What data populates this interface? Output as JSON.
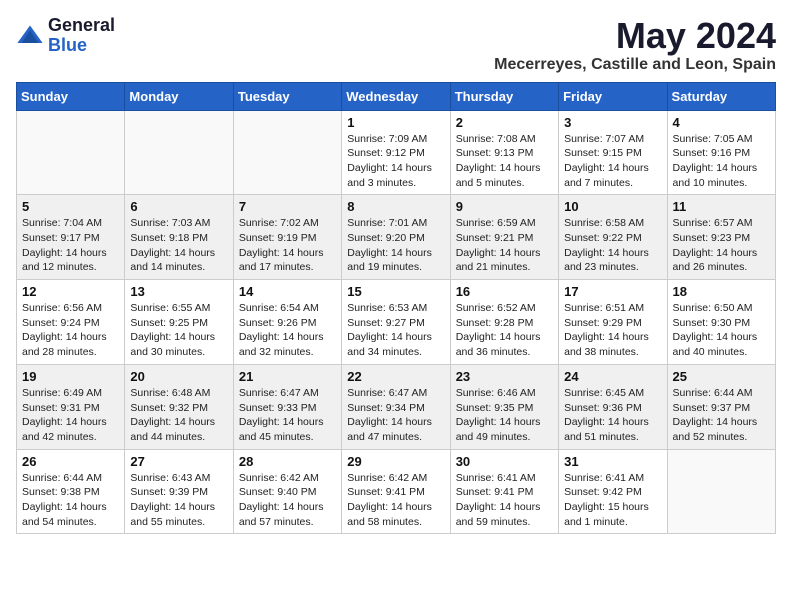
{
  "header": {
    "logo_general": "General",
    "logo_blue": "Blue",
    "title": "May 2024",
    "location": "Mecerreyes, Castille and Leon, Spain"
  },
  "columns": [
    "Sunday",
    "Monday",
    "Tuesday",
    "Wednesday",
    "Thursday",
    "Friday",
    "Saturday"
  ],
  "weeks": [
    [
      {
        "day": "",
        "info": ""
      },
      {
        "day": "",
        "info": ""
      },
      {
        "day": "",
        "info": ""
      },
      {
        "day": "1",
        "info": "Sunrise: 7:09 AM\nSunset: 9:12 PM\nDaylight: 14 hours\nand 3 minutes."
      },
      {
        "day": "2",
        "info": "Sunrise: 7:08 AM\nSunset: 9:13 PM\nDaylight: 14 hours\nand 5 minutes."
      },
      {
        "day": "3",
        "info": "Sunrise: 7:07 AM\nSunset: 9:15 PM\nDaylight: 14 hours\nand 7 minutes."
      },
      {
        "day": "4",
        "info": "Sunrise: 7:05 AM\nSunset: 9:16 PM\nDaylight: 14 hours\nand 10 minutes."
      }
    ],
    [
      {
        "day": "5",
        "info": "Sunrise: 7:04 AM\nSunset: 9:17 PM\nDaylight: 14 hours\nand 12 minutes."
      },
      {
        "day": "6",
        "info": "Sunrise: 7:03 AM\nSunset: 9:18 PM\nDaylight: 14 hours\nand 14 minutes."
      },
      {
        "day": "7",
        "info": "Sunrise: 7:02 AM\nSunset: 9:19 PM\nDaylight: 14 hours\nand 17 minutes."
      },
      {
        "day": "8",
        "info": "Sunrise: 7:01 AM\nSunset: 9:20 PM\nDaylight: 14 hours\nand 19 minutes."
      },
      {
        "day": "9",
        "info": "Sunrise: 6:59 AM\nSunset: 9:21 PM\nDaylight: 14 hours\nand 21 minutes."
      },
      {
        "day": "10",
        "info": "Sunrise: 6:58 AM\nSunset: 9:22 PM\nDaylight: 14 hours\nand 23 minutes."
      },
      {
        "day": "11",
        "info": "Sunrise: 6:57 AM\nSunset: 9:23 PM\nDaylight: 14 hours\nand 26 minutes."
      }
    ],
    [
      {
        "day": "12",
        "info": "Sunrise: 6:56 AM\nSunset: 9:24 PM\nDaylight: 14 hours\nand 28 minutes."
      },
      {
        "day": "13",
        "info": "Sunrise: 6:55 AM\nSunset: 9:25 PM\nDaylight: 14 hours\nand 30 minutes."
      },
      {
        "day": "14",
        "info": "Sunrise: 6:54 AM\nSunset: 9:26 PM\nDaylight: 14 hours\nand 32 minutes."
      },
      {
        "day": "15",
        "info": "Sunrise: 6:53 AM\nSunset: 9:27 PM\nDaylight: 14 hours\nand 34 minutes."
      },
      {
        "day": "16",
        "info": "Sunrise: 6:52 AM\nSunset: 9:28 PM\nDaylight: 14 hours\nand 36 minutes."
      },
      {
        "day": "17",
        "info": "Sunrise: 6:51 AM\nSunset: 9:29 PM\nDaylight: 14 hours\nand 38 minutes."
      },
      {
        "day": "18",
        "info": "Sunrise: 6:50 AM\nSunset: 9:30 PM\nDaylight: 14 hours\nand 40 minutes."
      }
    ],
    [
      {
        "day": "19",
        "info": "Sunrise: 6:49 AM\nSunset: 9:31 PM\nDaylight: 14 hours\nand 42 minutes."
      },
      {
        "day": "20",
        "info": "Sunrise: 6:48 AM\nSunset: 9:32 PM\nDaylight: 14 hours\nand 44 minutes."
      },
      {
        "day": "21",
        "info": "Sunrise: 6:47 AM\nSunset: 9:33 PM\nDaylight: 14 hours\nand 45 minutes."
      },
      {
        "day": "22",
        "info": "Sunrise: 6:47 AM\nSunset: 9:34 PM\nDaylight: 14 hours\nand 47 minutes."
      },
      {
        "day": "23",
        "info": "Sunrise: 6:46 AM\nSunset: 9:35 PM\nDaylight: 14 hours\nand 49 minutes."
      },
      {
        "day": "24",
        "info": "Sunrise: 6:45 AM\nSunset: 9:36 PM\nDaylight: 14 hours\nand 51 minutes."
      },
      {
        "day": "25",
        "info": "Sunrise: 6:44 AM\nSunset: 9:37 PM\nDaylight: 14 hours\nand 52 minutes."
      }
    ],
    [
      {
        "day": "26",
        "info": "Sunrise: 6:44 AM\nSunset: 9:38 PM\nDaylight: 14 hours\nand 54 minutes."
      },
      {
        "day": "27",
        "info": "Sunrise: 6:43 AM\nSunset: 9:39 PM\nDaylight: 14 hours\nand 55 minutes."
      },
      {
        "day": "28",
        "info": "Sunrise: 6:42 AM\nSunset: 9:40 PM\nDaylight: 14 hours\nand 57 minutes."
      },
      {
        "day": "29",
        "info": "Sunrise: 6:42 AM\nSunset: 9:41 PM\nDaylight: 14 hours\nand 58 minutes."
      },
      {
        "day": "30",
        "info": "Sunrise: 6:41 AM\nSunset: 9:41 PM\nDaylight: 14 hours\nand 59 minutes."
      },
      {
        "day": "31",
        "info": "Sunrise: 6:41 AM\nSunset: 9:42 PM\nDaylight: 15 hours\nand 1 minute."
      },
      {
        "day": "",
        "info": ""
      }
    ]
  ]
}
